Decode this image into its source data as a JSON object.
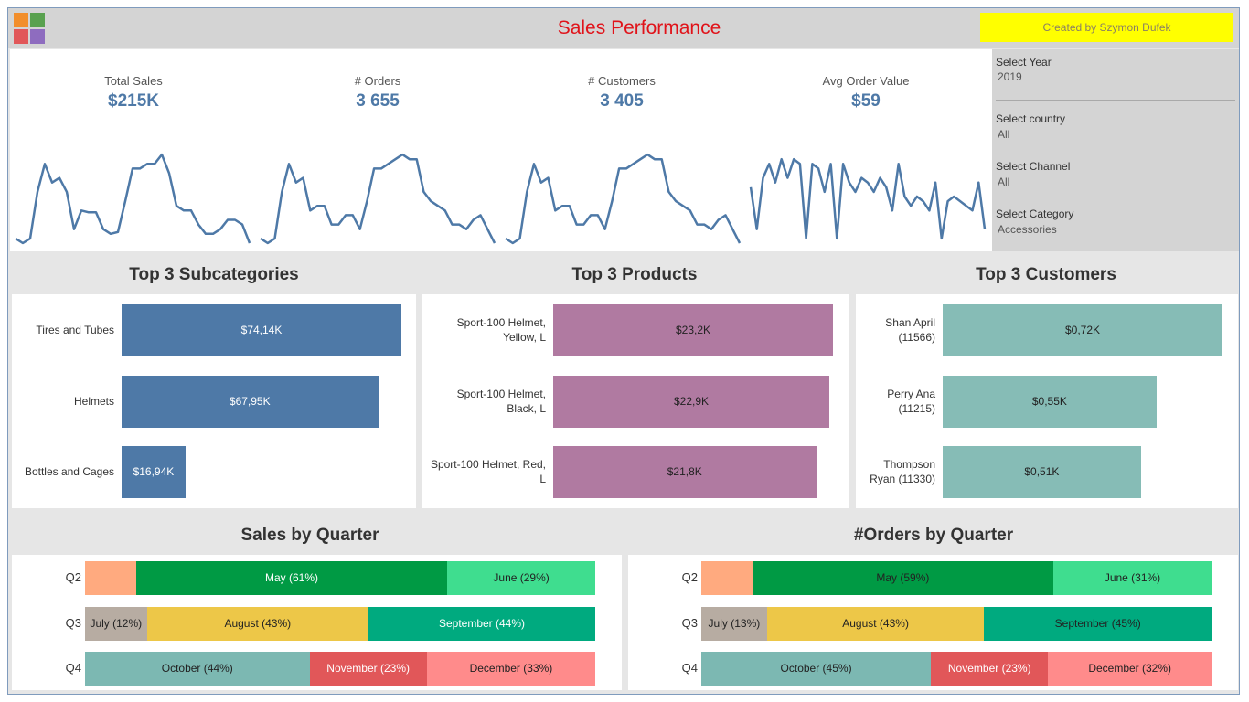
{
  "header": {
    "title": "Sales Performance",
    "credit": "Created by Szymon Dufek"
  },
  "colors": {
    "title": "#e0131a",
    "kpi": "#4e79a7",
    "subcategory_bar": "#4e79a7",
    "product_bar": "#b07aa1",
    "customer_bar": "#86bcb6",
    "April": "#ffaa7f",
    "May": "#009a44",
    "June": "#3fdd8f",
    "July": "#b7aca2",
    "August": "#edc748",
    "September": "#00aa7f",
    "October": "#7cb8b2",
    "November": "#e15759",
    "December": "#ff8b8b"
  },
  "kpis": [
    {
      "label": "Total Sales",
      "value": "$215K"
    },
    {
      "label": "# Orders",
      "value": "3 655"
    },
    {
      "label": "# Customers",
      "value": "3 405"
    },
    {
      "label": "Avg Order Value",
      "value": "$59"
    }
  ],
  "filters": [
    {
      "label": "Select Year",
      "value": "2019"
    },
    {
      "label": "Select country",
      "value": "All"
    },
    {
      "label": "Select Channel",
      "value": "All"
    },
    {
      "label": "Select Category",
      "value": "Accessories"
    }
  ],
  "chart_data": [
    {
      "type": "line",
      "title": "",
      "series": [
        {
          "values": [
            0.05,
            0.0,
            0.05,
            0.55,
            0.85,
            0.65,
            0.7,
            0.55,
            0.15,
            0.35,
            0.33,
            0.33,
            0.15,
            0.1,
            0.12,
            0.45,
            0.8,
            0.8,
            0.85,
            0.85,
            0.95,
            0.75,
            0.4,
            0.35,
            0.35,
            0.2,
            0.1,
            0.1,
            0.15,
            0.25,
            0.25,
            0.2,
            0.0
          ]
        }
      ]
    },
    {
      "type": "line",
      "title": "",
      "series": [
        {
          "values": [
            0.05,
            0.0,
            0.05,
            0.55,
            0.85,
            0.65,
            0.7,
            0.35,
            0.4,
            0.4,
            0.2,
            0.2,
            0.3,
            0.3,
            0.15,
            0.45,
            0.8,
            0.8,
            0.85,
            0.9,
            0.95,
            0.9,
            0.9,
            0.55,
            0.45,
            0.4,
            0.35,
            0.2,
            0.2,
            0.15,
            0.25,
            0.3,
            0.15,
            0.0
          ]
        }
      ]
    },
    {
      "type": "line",
      "title": "",
      "series": [
        {
          "values": [
            0.05,
            0.0,
            0.05,
            0.55,
            0.85,
            0.65,
            0.7,
            0.35,
            0.4,
            0.4,
            0.2,
            0.2,
            0.3,
            0.3,
            0.15,
            0.45,
            0.8,
            0.8,
            0.85,
            0.9,
            0.95,
            0.9,
            0.9,
            0.55,
            0.45,
            0.4,
            0.35,
            0.2,
            0.2,
            0.15,
            0.25,
            0.3,
            0.15,
            0.0
          ]
        }
      ]
    },
    {
      "type": "line",
      "title": "",
      "series": [
        {
          "values": [
            0.6,
            0.15,
            0.7,
            0.85,
            0.65,
            0.9,
            0.7,
            0.9,
            0.85,
            0.05,
            0.85,
            0.8,
            0.55,
            0.85,
            0.05,
            0.85,
            0.65,
            0.55,
            0.7,
            0.65,
            0.55,
            0.7,
            0.6,
            0.35,
            0.85,
            0.5,
            0.4,
            0.5,
            0.45,
            0.35,
            0.65,
            0.05,
            0.45,
            0.5,
            0.45,
            0.4,
            0.35,
            0.65,
            0.15
          ]
        }
      ]
    },
    {
      "type": "bar",
      "title": "Top 3 Subcategories",
      "categories": [
        "Tires and Tubes",
        "Helmets",
        "Bottles and Cages"
      ],
      "values": [
        74.14,
        67.95,
        16.94
      ],
      "data_labels": [
        "$74,14K",
        "$67,95K",
        "$16,94K"
      ]
    },
    {
      "type": "bar",
      "title": "Top 3 Products",
      "categories": [
        "Sport-100 Helmet, Yellow, L",
        "Sport-100 Helmet, Black, L",
        "Sport-100 Helmet, Red, L"
      ],
      "values": [
        23.2,
        22.9,
        21.8
      ],
      "data_labels": [
        "$23,2K",
        "$22,9K",
        "$21,8K"
      ]
    },
    {
      "type": "bar",
      "title": "Top 3 Customers",
      "categories": [
        "Shan April (11566)",
        "Perry Ana (11215)",
        "Thompson Ryan (11330)"
      ],
      "values": [
        0.72,
        0.55,
        0.51
      ],
      "data_labels": [
        "$0,72K",
        "$0,55K",
        "$0,51K"
      ]
    },
    {
      "type": "bar",
      "title": "Sales by Quarter",
      "categories": [
        "Q2",
        "Q3",
        "Q4"
      ],
      "series": [
        {
          "name": "Q2",
          "segments": [
            {
              "month": "April",
              "pct": 10,
              "label": ""
            },
            {
              "month": "May",
              "pct": 61,
              "label": "May (61%)"
            },
            {
              "month": "June",
              "pct": 29,
              "label": "June (29%)"
            }
          ]
        },
        {
          "name": "Q3",
          "segments": [
            {
              "month": "July",
              "pct": 12,
              "label": "July (12%)"
            },
            {
              "month": "August",
              "pct": 43,
              "label": "August (43%)"
            },
            {
              "month": "September",
              "pct": 44,
              "label": "September (44%)"
            }
          ]
        },
        {
          "name": "Q4",
          "segments": [
            {
              "month": "October",
              "pct": 44,
              "label": "October (44%)"
            },
            {
              "month": "November",
              "pct": 23,
              "label": "November (23%)"
            },
            {
              "month": "December",
              "pct": 33,
              "label": "December (33%)"
            }
          ]
        }
      ]
    },
    {
      "type": "bar",
      "title": "#Orders by Quarter",
      "categories": [
        "Q2",
        "Q3",
        "Q4"
      ],
      "series": [
        {
          "name": "Q2",
          "segments": [
            {
              "month": "April",
              "pct": 10,
              "label": ""
            },
            {
              "month": "May",
              "pct": 59,
              "label": "May (59%)"
            },
            {
              "month": "June",
              "pct": 31,
              "label": "June (31%)"
            }
          ]
        },
        {
          "name": "Q3",
          "segments": [
            {
              "month": "July",
              "pct": 13,
              "label": "July (13%)"
            },
            {
              "month": "August",
              "pct": 43,
              "label": "August (43%)"
            },
            {
              "month": "September",
              "pct": 45,
              "label": "September (45%)"
            }
          ]
        },
        {
          "name": "Q4",
          "segments": [
            {
              "month": "October",
              "pct": 45,
              "label": "October (45%)"
            },
            {
              "month": "November",
              "pct": 23,
              "label": "November (23%)"
            },
            {
              "month": "December",
              "pct": 32,
              "label": "December (32%)"
            }
          ]
        }
      ]
    }
  ]
}
